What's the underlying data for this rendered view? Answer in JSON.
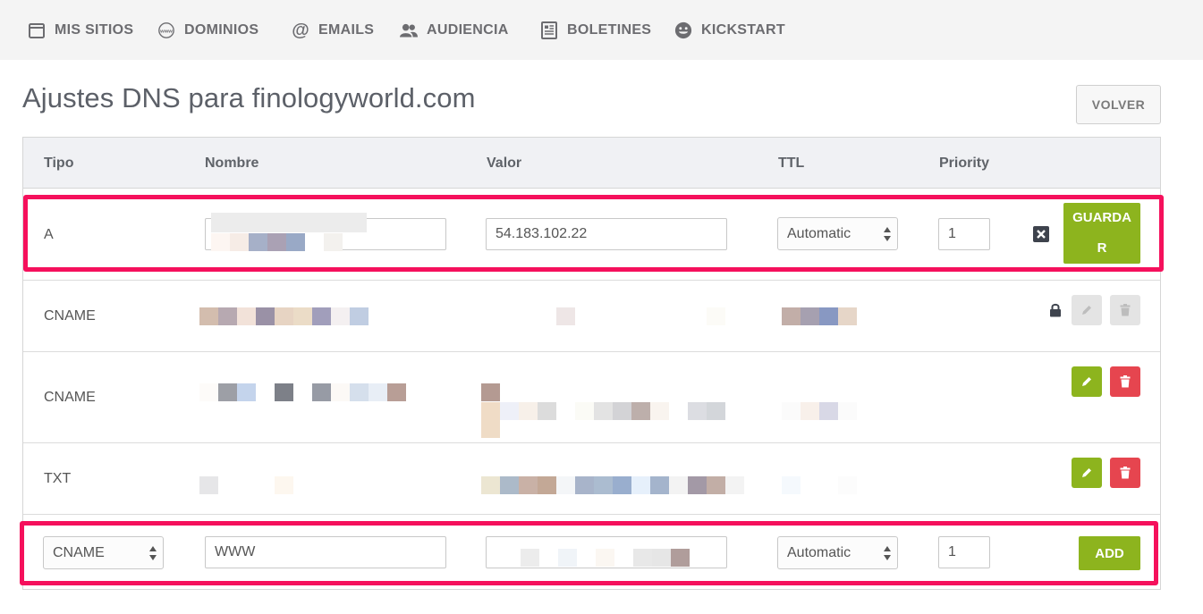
{
  "nav": {
    "items": [
      {
        "label": "MIS SITIOS",
        "icon": "browser-window-icon"
      },
      {
        "label": "DOMINIOS",
        "icon": "www-globe-icon"
      },
      {
        "label": "EMAILS",
        "icon": "at-sign-icon"
      },
      {
        "label": "AUDIENCIA",
        "icon": "users-icon"
      },
      {
        "label": "BOLETINES",
        "icon": "newsletter-icon"
      },
      {
        "label": "KICKSTART",
        "icon": "smiley-icon"
      }
    ]
  },
  "page": {
    "title": "Ajustes DNS para finologyworld.com",
    "back_label": "VOLVER"
  },
  "table": {
    "headers": {
      "tipo": "Tipo",
      "nombre": "Nombre",
      "valor": "Valor",
      "ttl": "TTL",
      "priority": "Priority"
    },
    "edit_row": {
      "type": "A",
      "valor": "54.183.102.22",
      "ttl": "Automatic",
      "priority": "1",
      "save_label_1": "GUARDA",
      "save_label_2": "R"
    },
    "rows": [
      {
        "type": "CNAME"
      },
      {
        "type": "CNAME"
      },
      {
        "type": "TXT"
      }
    ],
    "new_row": {
      "type": "CNAME",
      "nombre": "WWW",
      "ttl": "Automatic",
      "priority": "1",
      "add_label": "ADD"
    }
  },
  "colors": {
    "accent_green": "#8db41e",
    "danger_red": "#e6454f",
    "highlight": "#f5105c"
  }
}
